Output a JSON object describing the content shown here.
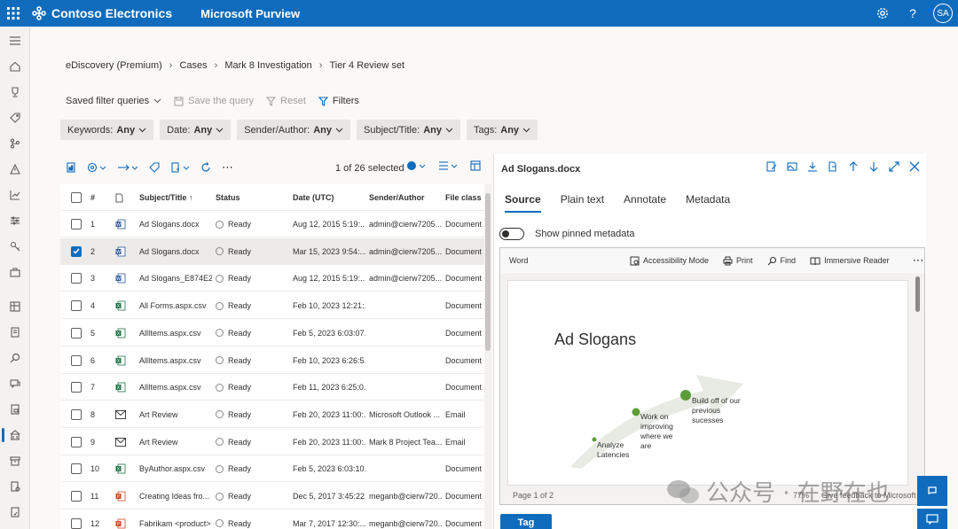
{
  "topbar": {
    "org": "Contoso Electronics",
    "product": "Microsoft Purview",
    "avatar_initials": "SA",
    "accent": "#0f6cbd"
  },
  "breadcrumb": [
    "eDiscovery (Premium)",
    "Cases",
    "Mark 8 Investigation",
    "Tier 4 Review set"
  ],
  "filterbar": {
    "saved_queries": "Saved filter queries",
    "save_query": "Save the query",
    "reset": "Reset",
    "filters": "Filters"
  },
  "filters": [
    {
      "label": "Keywords:",
      "value": "Any"
    },
    {
      "label": "Date:",
      "value": "Any"
    },
    {
      "label": "Sender/Author:",
      "value": "Any"
    },
    {
      "label": "Subject/Title:",
      "value": "Any"
    },
    {
      "label": "Tags:",
      "value": "Any"
    }
  ],
  "grid": {
    "selected_count": "1 of 26 selected",
    "columns": [
      "#",
      "Subject/Title ↑",
      "Status",
      "Date (UTC)",
      "Sender/Author",
      "File class"
    ],
    "rows": [
      {
        "num": "1",
        "icon": "word",
        "title": "Ad Slogans.docx",
        "status": "Ready",
        "date": "Aug 12, 2015 5:19:...",
        "sender": "admin@cierw7205...",
        "fileclass": "Document",
        "checked": false
      },
      {
        "num": "2",
        "icon": "word",
        "title": "Ad Slogans.docx",
        "status": "Ready",
        "date": "Mar 15, 2023 9:54:...",
        "sender": "admin@cierw7205...",
        "fileclass": "Document",
        "checked": true
      },
      {
        "num": "3",
        "icon": "word",
        "title": "Ad Slogans_E874E2...",
        "status": "Ready",
        "date": "Aug 12, 2015 5:19:...",
        "sender": "admin@cierw7205...",
        "fileclass": "Document",
        "checked": false
      },
      {
        "num": "4",
        "icon": "excel",
        "title": "All Forms.aspx.csv",
        "status": "Ready",
        "date": "Feb 10, 2023 12:21:...",
        "sender": "",
        "fileclass": "Document",
        "checked": false
      },
      {
        "num": "5",
        "icon": "excel",
        "title": "AllItems.aspx.csv",
        "status": "Ready",
        "date": "Feb 5, 2023 6:03:07...",
        "sender": "",
        "fileclass": "Document",
        "checked": false
      },
      {
        "num": "6",
        "icon": "excel",
        "title": "AllItems.aspx.csv",
        "status": "Ready",
        "date": "Feb 10, 2023 6:26:5...",
        "sender": "",
        "fileclass": "Document",
        "checked": false
      },
      {
        "num": "7",
        "icon": "excel",
        "title": "AllItems.aspx.csv",
        "status": "Ready",
        "date": "Feb 11, 2023 6:25:0...",
        "sender": "",
        "fileclass": "Document",
        "checked": false
      },
      {
        "num": "8",
        "icon": "mail",
        "title": "Art Review",
        "status": "Ready",
        "date": "Feb 20, 2023 11:00:...",
        "sender": "Microsoft Outlook ...",
        "fileclass": "Email",
        "checked": false
      },
      {
        "num": "9",
        "icon": "mail",
        "title": "Art Review",
        "status": "Ready",
        "date": "Feb 20, 2023 11:00:...",
        "sender": "Mark 8 Project Tea...",
        "fileclass": "Email",
        "checked": false
      },
      {
        "num": "10",
        "icon": "excel",
        "title": "ByAuthor.aspx.csv",
        "status": "Ready",
        "date": "Feb 5, 2023 6:03:10...",
        "sender": "",
        "fileclass": "Document",
        "checked": false
      },
      {
        "num": "11",
        "icon": "ppt",
        "title": "Creating Ideas fro...",
        "status": "Ready",
        "date": "Dec 5, 2017 3:45:22...",
        "sender": "meganb@cierw720...",
        "fileclass": "Document",
        "checked": false
      },
      {
        "num": "12",
        "icon": "ppt",
        "title": "Fabrikam <product>",
        "status": "Ready",
        "date": "Mar 7, 2017 12:30:...",
        "sender": "meganb@cierw720...",
        "fileclass": "Document",
        "checked": false
      }
    ]
  },
  "preview": {
    "title": "Ad Slogans.docx",
    "tabs": [
      "Source",
      "Plain text",
      "Annotate",
      "Metadata"
    ],
    "active_tab": "Source",
    "pinned_toggle_label": "Show pinned metadata",
    "viewer": {
      "app": "Word",
      "actions": [
        "Accessibility Mode",
        "Print",
        "Find",
        "Immersive Reader"
      ],
      "doc_title": "Ad Slogans",
      "diagram_labels": [
        "Analyze Latencies",
        "Work on improving where we are",
        "Build off of our previous sucesses"
      ],
      "page_indicator": "Page 1 of 2",
      "zoom": "77%",
      "feedback": "Give feedback to Microsoft"
    },
    "tag_button": "Tag"
  },
  "watermark": "公众号 · 在野在也"
}
